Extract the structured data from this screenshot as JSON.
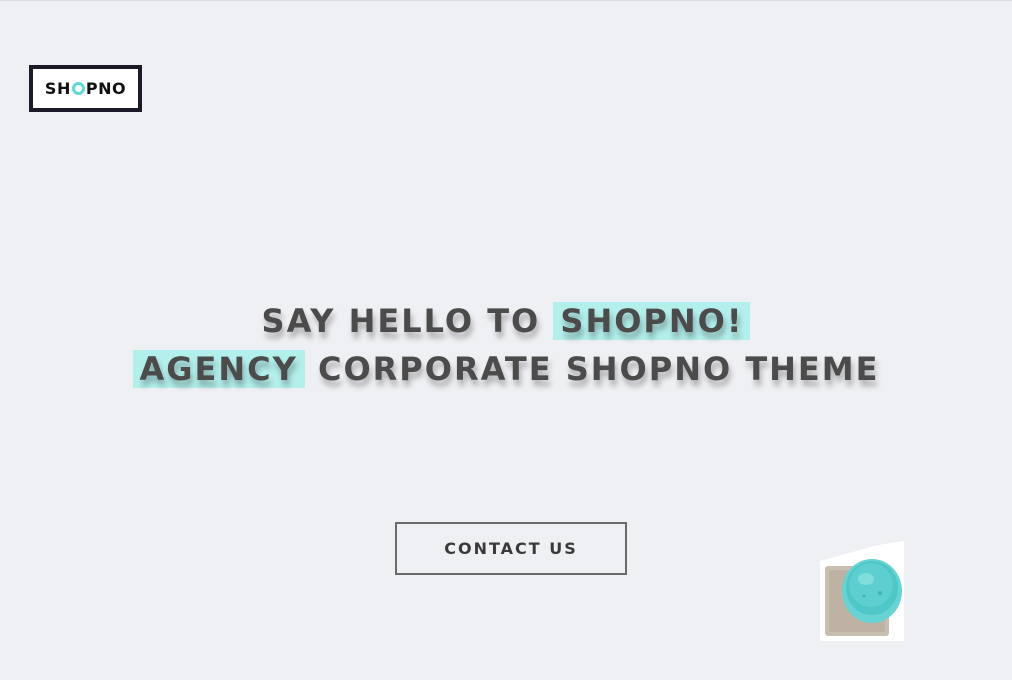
{
  "logo": {
    "text_before": "SH",
    "text_after": "PNO"
  },
  "hero": {
    "line1_plain": "SAY HELLO TO ",
    "line1_highlight": "SHOPNO!",
    "line2_highlight": "AGENCY",
    "line2_plain": " CORPORATE SHOPNO THEME"
  },
  "contact_button": {
    "label": "CONTACT US"
  },
  "colors": {
    "background": "#eff0f3",
    "highlight": "#b3efeb",
    "accent": "#5fd8d8",
    "text": "#4b4b4b"
  },
  "icons": {
    "product_image": "smoothie-cup-on-coaster-image"
  }
}
